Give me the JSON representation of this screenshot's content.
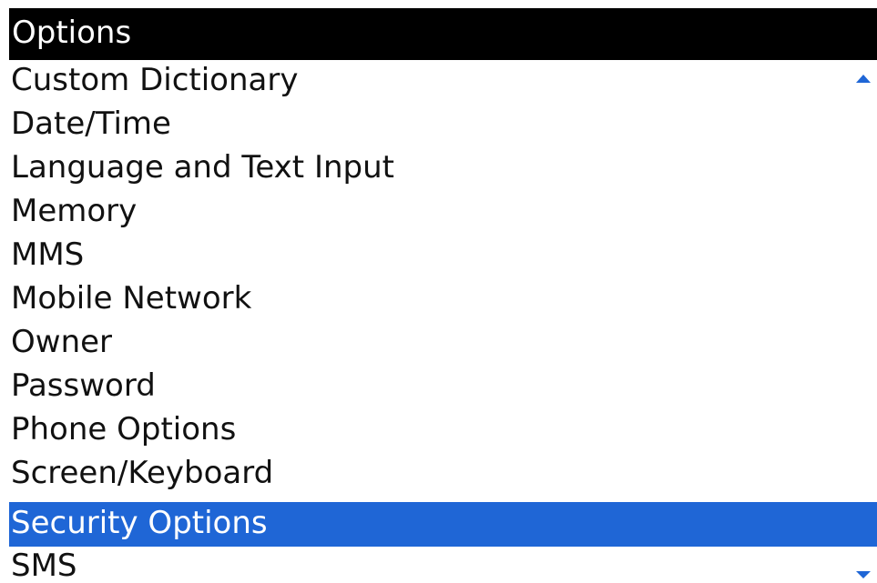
{
  "header": {
    "title": "Options"
  },
  "menu": {
    "items": [
      {
        "label": "Custom Dictionary"
      },
      {
        "label": "Date/Time"
      },
      {
        "label": "Language and Text Input"
      },
      {
        "label": "Memory"
      },
      {
        "label": "MMS"
      },
      {
        "label": "Mobile Network"
      },
      {
        "label": "Owner"
      },
      {
        "label": "Password"
      },
      {
        "label": "Phone Options"
      },
      {
        "label": "Screen/Keyboard"
      },
      {
        "label": "Security Options",
        "selected": true
      },
      {
        "label": "SMS"
      }
    ]
  },
  "scroll": {
    "up_icon": "triangle-up",
    "down_icon": "triangle-down"
  },
  "colors": {
    "header_background": "#000000",
    "header_text": "#ffffff",
    "selection": "#1F66D6",
    "text": "#111111"
  }
}
